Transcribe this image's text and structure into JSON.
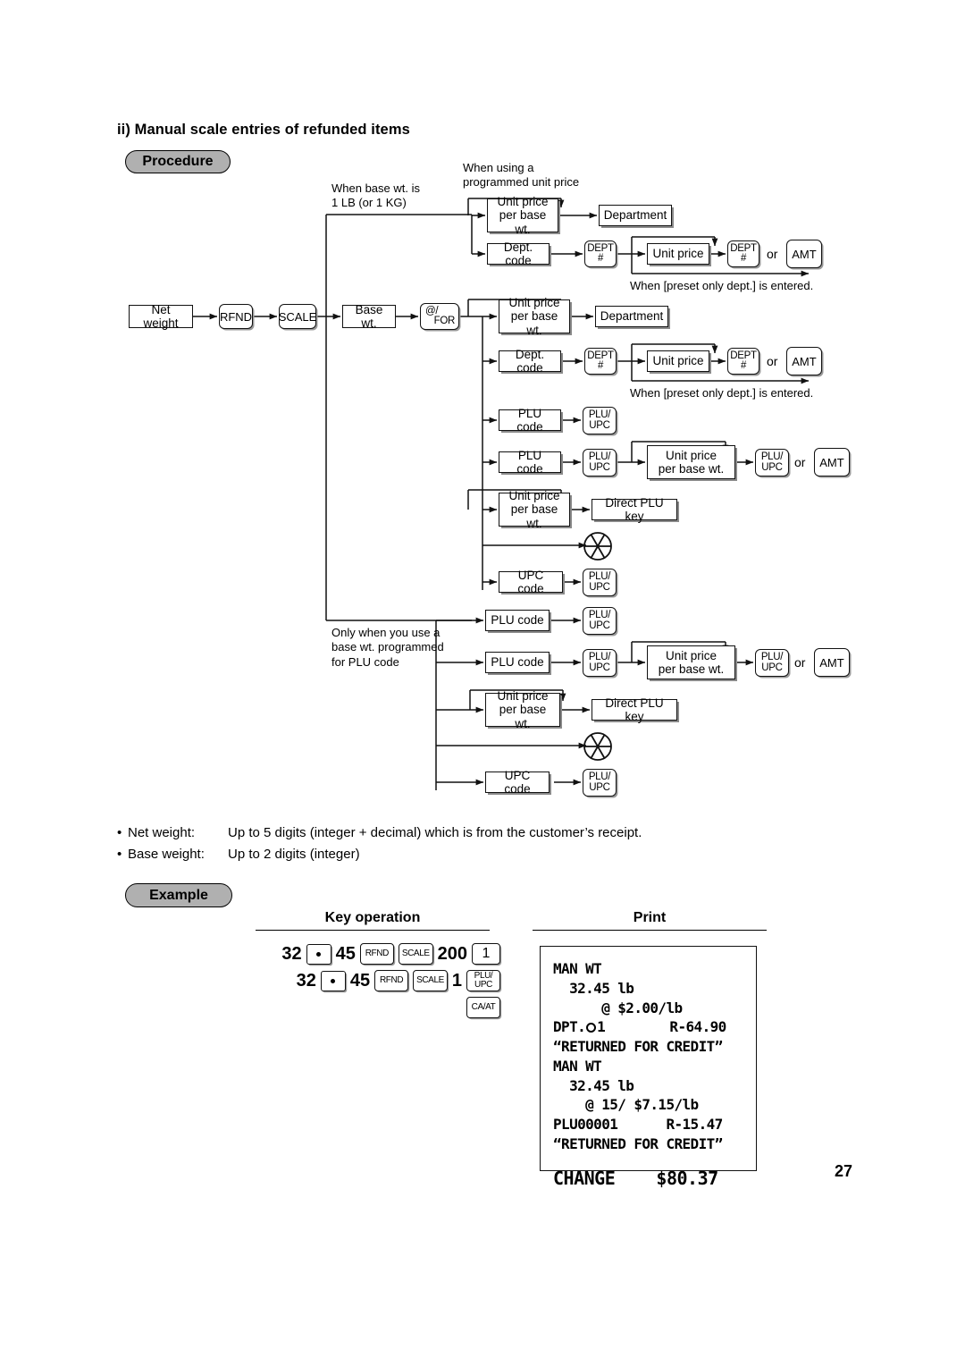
{
  "section": {
    "heading": "ii) Manual scale entries of refunded items"
  },
  "badges": {
    "procedure": "Procedure",
    "example": "Example"
  },
  "flow": {
    "notes": {
      "base_wt": "When base wt. is\n1 LB (or 1 KG)",
      "programmed_price": "When using a\nprogrammed unit price",
      "preset_dept_1": "When [preset only dept.] is entered.",
      "preset_dept_2": "When [preset only dept.] is entered.",
      "plu_base_wt": "Only when you use a\nbase wt. programmed\nfor PLU code"
    },
    "start": {
      "net_weight": "Net weight",
      "rfnd_key": "RFND",
      "scale_key": "SCALE",
      "base_wt": "Base wt.",
      "for_key_top": "@/",
      "for_key_bottom": "FOR"
    },
    "labels": {
      "unit_price_per_base_wt_l1": "Unit price",
      "unit_price_per_base_wt_l2": "per base wt.",
      "department": "Department",
      "dept_code": "Dept. code",
      "unit_price": "Unit price",
      "plu_code": "PLU code",
      "upc_code": "UPC code",
      "direct_plu_key": "Direct PLU key",
      "or": "or"
    },
    "keys": {
      "dept_top": "DEPT",
      "dept_bottom": "#",
      "amt": "AMT",
      "plu_top": "PLU/",
      "plu_bottom": "UPC"
    },
    "icons": {
      "scan_symbol": "upc-scan-symbol"
    }
  },
  "notes": {
    "net_weight_label": "Net weight:",
    "net_weight_value": "Up to 5 digits (integer + decimal) which is from the customer’s receipt.",
    "base_weight_label": "Base weight:",
    "base_weight_value": "Up to 2 digits (integer)",
    "bullet": "•"
  },
  "example": {
    "key_operation_title": "Key operation",
    "print_title": "Print",
    "key_sequence": [
      {
        "items": [
          {
            "type": "num",
            "text": "32"
          },
          {
            "type": "dot",
            "text": "·"
          },
          {
            "type": "num",
            "text": "45"
          },
          {
            "type": "key",
            "text": "RFND"
          },
          {
            "type": "key",
            "text": "SCALE"
          },
          {
            "type": "num",
            "text": "200"
          },
          {
            "type": "key1",
            "text": "1"
          }
        ]
      },
      {
        "items": [
          {
            "type": "num",
            "text": "32"
          },
          {
            "type": "dot",
            "text": "·"
          },
          {
            "type": "num",
            "text": "45"
          },
          {
            "type": "key",
            "text": "RFND"
          },
          {
            "type": "key",
            "text": "SCALE"
          },
          {
            "type": "num",
            "text": "1"
          },
          {
            "type": "key2",
            "text": "PLU/",
            "text2": "UPC"
          }
        ]
      }
    ],
    "key_sequence_tail": {
      "type": "key",
      "text": "CA/AT"
    }
  },
  "receipt": {
    "lines": [
      {
        "text": "MAN WT",
        "style": "normal"
      },
      {
        "text": "  32.45 lb",
        "style": "normal"
      },
      {
        "text": "      @ $2.00/lb",
        "style": "normal"
      },
      {
        "text": "DPT.○1        R-64.90",
        "style": "dpt",
        "prefix": "DPT.",
        "suffix": "1        R-64.90"
      },
      {
        "text": "“RETURNED FOR CREDIT”",
        "style": "normal"
      },
      {
        "text": "MAN WT",
        "style": "normal"
      },
      {
        "text": "  32.45 lb",
        "style": "normal"
      },
      {
        "text": "    @ 15/ $7.15/lb",
        "style": "normal"
      },
      {
        "text": "PLU00001      R-15.47",
        "style": "normal"
      },
      {
        "text": "“RETURNED FOR CREDIT”",
        "style": "normal"
      },
      {
        "text": "CHANGE    $80.37",
        "style": "big"
      }
    ]
  },
  "page": {
    "number": "27"
  }
}
